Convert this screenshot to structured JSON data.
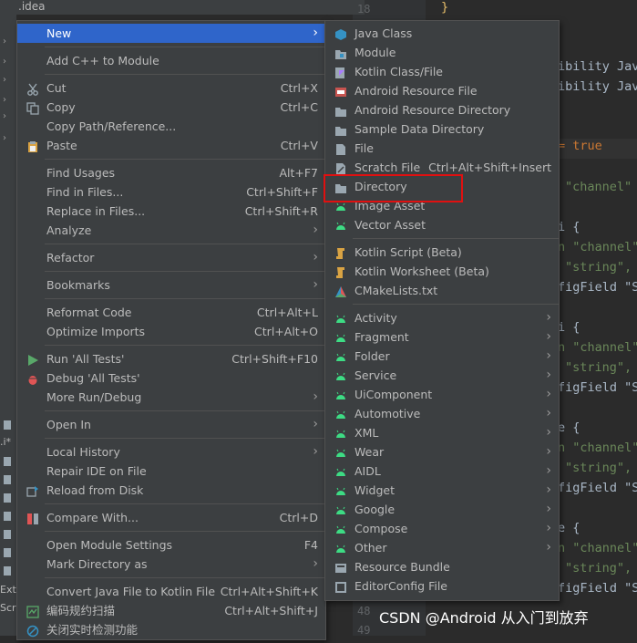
{
  "project": {
    "root_label": ".idea",
    "side_labels": [
      ".i*",
      "Ext",
      "Scr"
    ]
  },
  "editor": {
    "gutter_numbers": [
      "18",
      "48",
      "49"
    ],
    "lines": [
      {
        "text": "}",
        "cls": "brace"
      },
      {
        "text": "ibility Jav",
        "cls": ""
      },
      {
        "text": "ibility Jav",
        "cls": ""
      },
      {
        "text": "= true",
        "cls": "kw"
      },
      {
        "text": "\"channel\"",
        "cls": "str"
      },
      {
        "text": "i {",
        "cls": ""
      },
      {
        "text": "n \"channel\"",
        "cls": "str"
      },
      {
        "text": "\"string\",",
        "cls": "str"
      },
      {
        "text": "figField \"S",
        "cls": ""
      },
      {
        "text": "i {",
        "cls": ""
      },
      {
        "text": "n \"channel\"",
        "cls": "str"
      },
      {
        "text": "\"string\",",
        "cls": "str"
      },
      {
        "text": "figField \"S",
        "cls": ""
      },
      {
        "text": "e {",
        "cls": ""
      },
      {
        "text": "n \"channel\"",
        "cls": "str"
      },
      {
        "text": "\"string\",",
        "cls": "str"
      },
      {
        "text": "figField \"S",
        "cls": ""
      },
      {
        "text": "e {",
        "cls": ""
      },
      {
        "text": "n \"channel\"",
        "cls": "str"
      },
      {
        "text": "\"string\",",
        "cls": "str"
      },
      {
        "text": "figField \"S",
        "cls": ""
      }
    ]
  },
  "watermark": "CSDN @Android 从入门到放弃",
  "main_menu": {
    "items": [
      {
        "label": "New",
        "shortcut": "",
        "submenu": true,
        "selected": true,
        "icon": ""
      },
      {
        "sep": true
      },
      {
        "label": "Add C++ to Module",
        "shortcut": "",
        "icon": ""
      },
      {
        "sep": true
      },
      {
        "label": "Cut",
        "shortcut": "Ctrl+X",
        "icon": "scissors-icon"
      },
      {
        "label": "Copy",
        "shortcut": "Ctrl+C",
        "icon": "copy-icon"
      },
      {
        "label": "Copy Path/Reference...",
        "shortcut": "",
        "icon": ""
      },
      {
        "label": "Paste",
        "shortcut": "Ctrl+V",
        "icon": "clipboard-icon"
      },
      {
        "sep": true
      },
      {
        "label": "Find Usages",
        "shortcut": "Alt+F7",
        "icon": ""
      },
      {
        "label": "Find in Files...",
        "shortcut": "Ctrl+Shift+F",
        "icon": ""
      },
      {
        "label": "Replace in Files...",
        "shortcut": "Ctrl+Shift+R",
        "icon": ""
      },
      {
        "label": "Analyze",
        "shortcut": "",
        "submenu": true,
        "icon": ""
      },
      {
        "sep": true
      },
      {
        "label": "Refactor",
        "shortcut": "",
        "submenu": true,
        "icon": ""
      },
      {
        "sep": true
      },
      {
        "label": "Bookmarks",
        "shortcut": "",
        "submenu": true,
        "icon": ""
      },
      {
        "sep": true
      },
      {
        "label": "Reformat Code",
        "shortcut": "Ctrl+Alt+L",
        "icon": ""
      },
      {
        "label": "Optimize Imports",
        "shortcut": "Ctrl+Alt+O",
        "icon": ""
      },
      {
        "sep": true
      },
      {
        "label": "Run 'All Tests'",
        "shortcut": "Ctrl+Shift+F10",
        "icon": "run-icon"
      },
      {
        "label": "Debug 'All Tests'",
        "shortcut": "",
        "icon": "debug-icon"
      },
      {
        "label": "More Run/Debug",
        "shortcut": "",
        "submenu": true,
        "icon": ""
      },
      {
        "sep": true
      },
      {
        "label": "Open In",
        "shortcut": "",
        "submenu": true,
        "icon": ""
      },
      {
        "sep": true
      },
      {
        "label": "Local History",
        "shortcut": "",
        "submenu": true,
        "icon": ""
      },
      {
        "label": "Repair IDE on File",
        "shortcut": "",
        "icon": ""
      },
      {
        "label": "Reload from Disk",
        "shortcut": "",
        "icon": "reload-icon"
      },
      {
        "sep": true
      },
      {
        "label": "Compare With...",
        "shortcut": "Ctrl+D",
        "icon": "compare-icon"
      },
      {
        "sep": true
      },
      {
        "label": "Open Module Settings",
        "shortcut": "F4",
        "icon": ""
      },
      {
        "label": "Mark Directory as",
        "shortcut": "",
        "submenu": true,
        "icon": ""
      },
      {
        "sep": true
      },
      {
        "label": "Convert Java File to Kotlin File",
        "shortcut": "Ctrl+Alt+Shift+K",
        "icon": ""
      },
      {
        "label": "编码规约扫描",
        "shortcut": "Ctrl+Alt+Shift+J",
        "icon": "scan-icon"
      },
      {
        "label": "关闭实时检测功能",
        "shortcut": "",
        "icon": "disable-icon"
      }
    ]
  },
  "sub_menu": {
    "items": [
      {
        "label": "Java Class",
        "shortcut": "",
        "icon": "java-class-icon"
      },
      {
        "label": "Module",
        "shortcut": "",
        "icon": "module-icon"
      },
      {
        "label": "Kotlin Class/File",
        "shortcut": "",
        "icon": "kotlin-class-icon"
      },
      {
        "label": "Android Resource File",
        "shortcut": "",
        "icon": "android-resource-file-icon"
      },
      {
        "label": "Android Resource Directory",
        "shortcut": "",
        "icon": "folder-icon"
      },
      {
        "label": "Sample Data Directory",
        "shortcut": "",
        "icon": "folder-icon"
      },
      {
        "label": "File",
        "shortcut": "",
        "icon": "file-icon"
      },
      {
        "label": "Scratch File",
        "shortcut": "Ctrl+Alt+Shift+Insert",
        "icon": "scratch-file-icon"
      },
      {
        "label": "Directory",
        "shortcut": "",
        "icon": "folder-icon"
      },
      {
        "label": "Image Asset",
        "shortcut": "",
        "icon": "android-icon"
      },
      {
        "label": "Vector Asset",
        "shortcut": "",
        "icon": "android-icon"
      },
      {
        "sep": true
      },
      {
        "label": "Kotlin Script (Beta)",
        "shortcut": "",
        "icon": "kotlin-script-icon"
      },
      {
        "label": "Kotlin Worksheet (Beta)",
        "shortcut": "",
        "icon": "kotlin-script-icon"
      },
      {
        "label": "CMakeLists.txt",
        "shortcut": "",
        "icon": "cmake-icon"
      },
      {
        "sep": true
      },
      {
        "label": "Activity",
        "submenu": true,
        "icon": "android-icon"
      },
      {
        "label": "Fragment",
        "submenu": true,
        "icon": "android-icon"
      },
      {
        "label": "Folder",
        "submenu": true,
        "icon": "android-icon"
      },
      {
        "label": "Service",
        "submenu": true,
        "icon": "android-icon"
      },
      {
        "label": "UiComponent",
        "submenu": true,
        "icon": "android-icon"
      },
      {
        "label": "Automotive",
        "submenu": true,
        "icon": "android-icon"
      },
      {
        "label": "XML",
        "submenu": true,
        "icon": "android-icon"
      },
      {
        "label": "Wear",
        "submenu": true,
        "icon": "android-icon"
      },
      {
        "label": "AIDL",
        "submenu": true,
        "icon": "android-icon"
      },
      {
        "label": "Widget",
        "submenu": true,
        "icon": "android-icon"
      },
      {
        "label": "Google",
        "submenu": true,
        "icon": "android-icon"
      },
      {
        "label": "Compose",
        "submenu": true,
        "icon": "android-icon"
      },
      {
        "label": "Other",
        "submenu": true,
        "icon": "android-icon"
      },
      {
        "label": "Resource Bundle",
        "shortcut": "",
        "icon": "resource-bundle-icon"
      },
      {
        "label": "EditorConfig File",
        "shortcut": "",
        "icon": "editorconfig-icon"
      }
    ]
  },
  "colors": {
    "selection": "#2f65ca",
    "highlight_box": "#e01010",
    "android_green": "#3ddc84"
  }
}
